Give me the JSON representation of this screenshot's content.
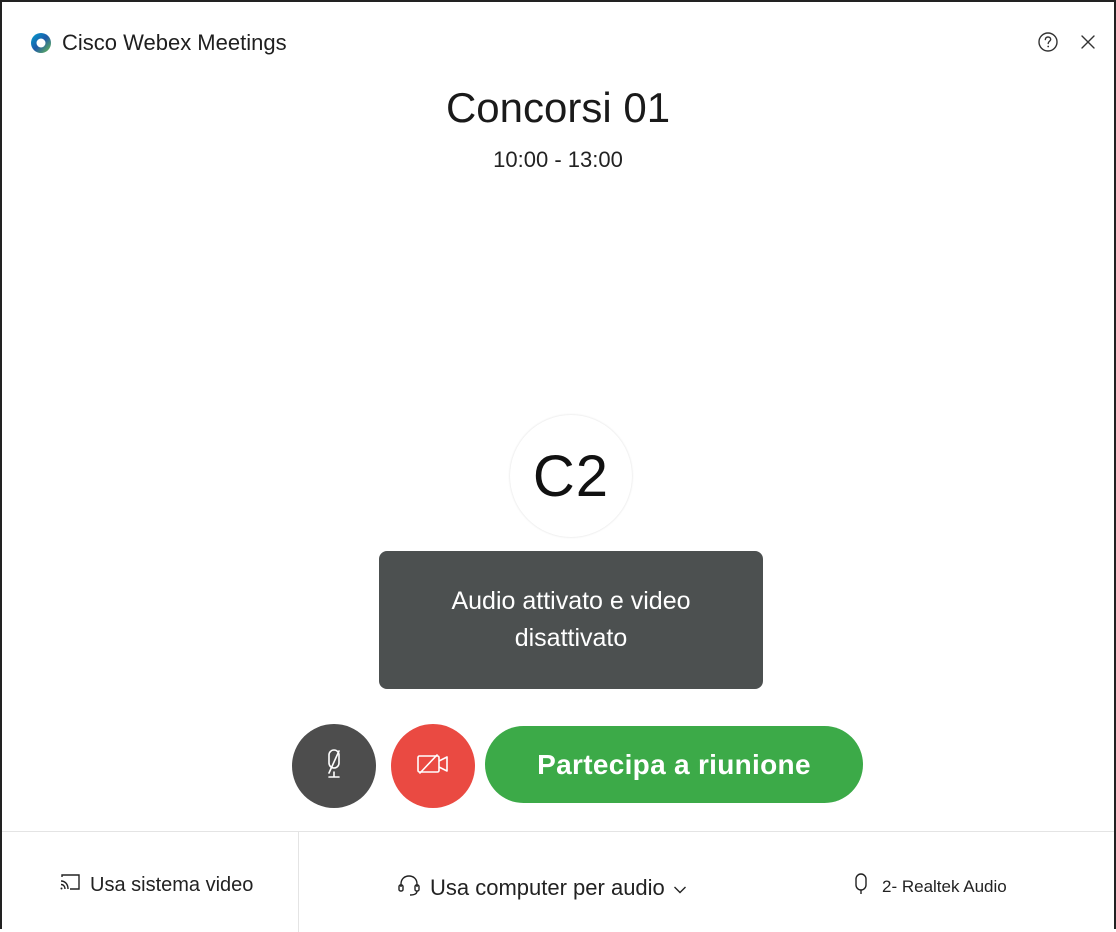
{
  "window": {
    "app_title": "Cisco Webex Meetings"
  },
  "meeting": {
    "title": "Concorsi 01",
    "time": "10:00 - 13:00",
    "avatar_initials": "C2"
  },
  "tooltip": {
    "text_line1": "Audio attivato e video",
    "text_line2": "disattivato"
  },
  "controls": {
    "join_label": "Partecipa a riunione"
  },
  "footer": {
    "video_system_label": "Usa sistema video",
    "audio_label": "Usa computer per audio",
    "mic_label": "2- Realtek Audio"
  },
  "colors": {
    "join_green": "#3caa48",
    "video_off_red": "#ea4a42",
    "mute_gray": "#4d4d4d",
    "tooltip_bg": "#4c5050"
  },
  "icons": {
    "logo": "webex-logo-icon",
    "help": "help-icon",
    "close": "close-icon",
    "mute": "microphone-muted-icon",
    "video_off": "video-off-icon",
    "cast": "cast-icon",
    "headset": "headset-icon",
    "chevron": "chevron-down-icon",
    "mic": "microphone-icon"
  }
}
